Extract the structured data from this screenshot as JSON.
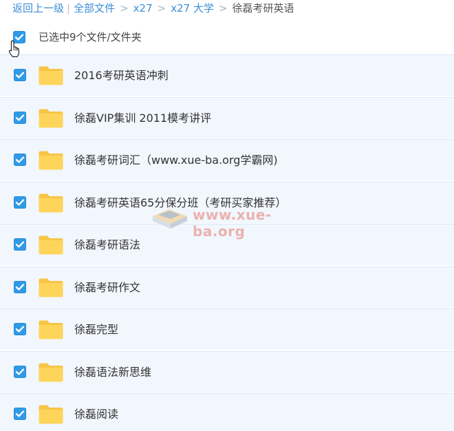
{
  "breadcrumb": {
    "back": "返回上一级",
    "separator_pipe": "|",
    "chevron": ">",
    "items": [
      "全部文件",
      "x27",
      "x27 大学"
    ],
    "current": "徐磊考研英语"
  },
  "selection": {
    "checked": true,
    "text": "已选中9个文件/文件夹"
  },
  "folders": [
    {
      "name": "2016考研英语冲刺",
      "checked": true
    },
    {
      "name": "徐磊VIP集训 2011模考讲评",
      "checked": true
    },
    {
      "name": "徐磊考研词汇（www.xue-ba.org学霸网)",
      "checked": true
    },
    {
      "name": "徐磊考研英语65分保分班（考研买家推荐）",
      "checked": true
    },
    {
      "name": "徐磊考研语法",
      "checked": true
    },
    {
      "name": "徐磊考研作文",
      "checked": true
    },
    {
      "name": "徐磊完型",
      "checked": true
    },
    {
      "name": "徐磊语法新思维",
      "checked": true
    },
    {
      "name": "徐磊阅读",
      "checked": true
    }
  ],
  "watermark": {
    "text": "www.xue-ba.org"
  },
  "colors": {
    "accent": "#3b8ed6",
    "checkbox": "#2f9ae8",
    "row_background": "#f1f7fd",
    "folder": "#ffd45a"
  },
  "icons": {
    "checkbox": "checkbox-checked-icon",
    "folder": "folder-icon",
    "cursor": "hand-pointer-icon"
  }
}
